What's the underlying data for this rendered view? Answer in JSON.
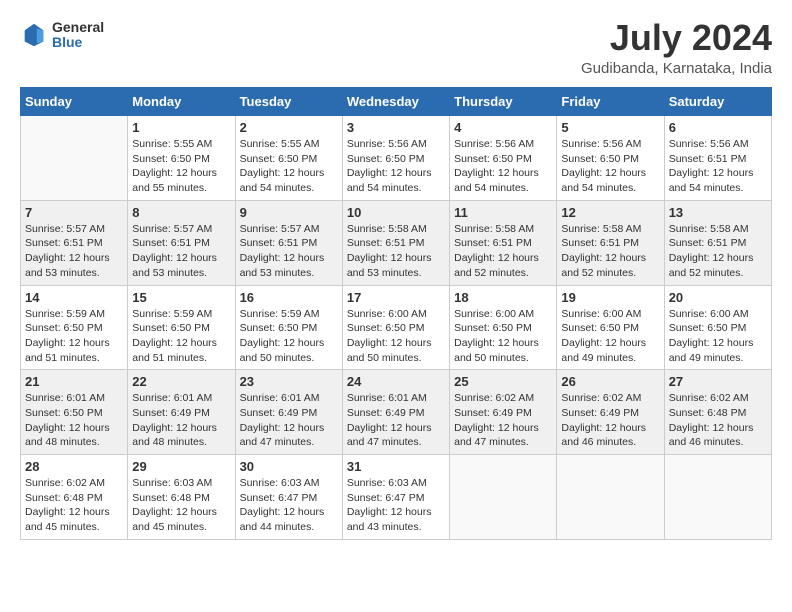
{
  "header": {
    "logo": {
      "line1": "General",
      "line2": "Blue"
    },
    "title": "July 2024",
    "location": "Gudibanda, Karnataka, India"
  },
  "days_of_week": [
    "Sunday",
    "Monday",
    "Tuesday",
    "Wednesday",
    "Thursday",
    "Friday",
    "Saturday"
  ],
  "weeks": [
    [
      {
        "day": null
      },
      {
        "day": 1,
        "sunrise": "5:55 AM",
        "sunset": "6:50 PM",
        "daylight": "12 hours and 55 minutes."
      },
      {
        "day": 2,
        "sunrise": "5:55 AM",
        "sunset": "6:50 PM",
        "daylight": "12 hours and 54 minutes."
      },
      {
        "day": 3,
        "sunrise": "5:56 AM",
        "sunset": "6:50 PM",
        "daylight": "12 hours and 54 minutes."
      },
      {
        "day": 4,
        "sunrise": "5:56 AM",
        "sunset": "6:50 PM",
        "daylight": "12 hours and 54 minutes."
      },
      {
        "day": 5,
        "sunrise": "5:56 AM",
        "sunset": "6:50 PM",
        "daylight": "12 hours and 54 minutes."
      },
      {
        "day": 6,
        "sunrise": "5:56 AM",
        "sunset": "6:51 PM",
        "daylight": "12 hours and 54 minutes."
      }
    ],
    [
      {
        "day": 7,
        "sunrise": "5:57 AM",
        "sunset": "6:51 PM",
        "daylight": "12 hours and 53 minutes."
      },
      {
        "day": 8,
        "sunrise": "5:57 AM",
        "sunset": "6:51 PM",
        "daylight": "12 hours and 53 minutes."
      },
      {
        "day": 9,
        "sunrise": "5:57 AM",
        "sunset": "6:51 PM",
        "daylight": "12 hours and 53 minutes."
      },
      {
        "day": 10,
        "sunrise": "5:58 AM",
        "sunset": "6:51 PM",
        "daylight": "12 hours and 53 minutes."
      },
      {
        "day": 11,
        "sunrise": "5:58 AM",
        "sunset": "6:51 PM",
        "daylight": "12 hours and 52 minutes."
      },
      {
        "day": 12,
        "sunrise": "5:58 AM",
        "sunset": "6:51 PM",
        "daylight": "12 hours and 52 minutes."
      },
      {
        "day": 13,
        "sunrise": "5:58 AM",
        "sunset": "6:51 PM",
        "daylight": "12 hours and 52 minutes."
      }
    ],
    [
      {
        "day": 14,
        "sunrise": "5:59 AM",
        "sunset": "6:50 PM",
        "daylight": "12 hours and 51 minutes."
      },
      {
        "day": 15,
        "sunrise": "5:59 AM",
        "sunset": "6:50 PM",
        "daylight": "12 hours and 51 minutes."
      },
      {
        "day": 16,
        "sunrise": "5:59 AM",
        "sunset": "6:50 PM",
        "daylight": "12 hours and 50 minutes."
      },
      {
        "day": 17,
        "sunrise": "6:00 AM",
        "sunset": "6:50 PM",
        "daylight": "12 hours and 50 minutes."
      },
      {
        "day": 18,
        "sunrise": "6:00 AM",
        "sunset": "6:50 PM",
        "daylight": "12 hours and 50 minutes."
      },
      {
        "day": 19,
        "sunrise": "6:00 AM",
        "sunset": "6:50 PM",
        "daylight": "12 hours and 49 minutes."
      },
      {
        "day": 20,
        "sunrise": "6:00 AM",
        "sunset": "6:50 PM",
        "daylight": "12 hours and 49 minutes."
      }
    ],
    [
      {
        "day": 21,
        "sunrise": "6:01 AM",
        "sunset": "6:50 PM",
        "daylight": "12 hours and 48 minutes."
      },
      {
        "day": 22,
        "sunrise": "6:01 AM",
        "sunset": "6:49 PM",
        "daylight": "12 hours and 48 minutes."
      },
      {
        "day": 23,
        "sunrise": "6:01 AM",
        "sunset": "6:49 PM",
        "daylight": "12 hours and 47 minutes."
      },
      {
        "day": 24,
        "sunrise": "6:01 AM",
        "sunset": "6:49 PM",
        "daylight": "12 hours and 47 minutes."
      },
      {
        "day": 25,
        "sunrise": "6:02 AM",
        "sunset": "6:49 PM",
        "daylight": "12 hours and 47 minutes."
      },
      {
        "day": 26,
        "sunrise": "6:02 AM",
        "sunset": "6:49 PM",
        "daylight": "12 hours and 46 minutes."
      },
      {
        "day": 27,
        "sunrise": "6:02 AM",
        "sunset": "6:48 PM",
        "daylight": "12 hours and 46 minutes."
      }
    ],
    [
      {
        "day": 28,
        "sunrise": "6:02 AM",
        "sunset": "6:48 PM",
        "daylight": "12 hours and 45 minutes."
      },
      {
        "day": 29,
        "sunrise": "6:03 AM",
        "sunset": "6:48 PM",
        "daylight": "12 hours and 45 minutes."
      },
      {
        "day": 30,
        "sunrise": "6:03 AM",
        "sunset": "6:47 PM",
        "daylight": "12 hours and 44 minutes."
      },
      {
        "day": 31,
        "sunrise": "6:03 AM",
        "sunset": "6:47 PM",
        "daylight": "12 hours and 43 minutes."
      },
      {
        "day": null
      },
      {
        "day": null
      },
      {
        "day": null
      }
    ]
  ]
}
